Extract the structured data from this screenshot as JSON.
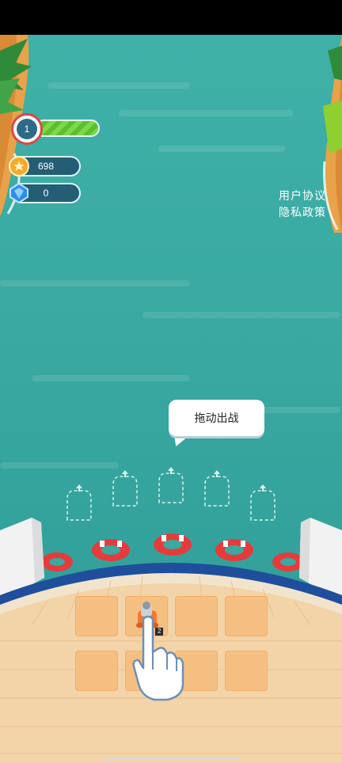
{
  "hud": {
    "level": "1",
    "level_progress": 1.0,
    "coins": "698",
    "gems": "0"
  },
  "legal": {
    "user_agreement": "用户协议",
    "privacy_policy": "隐私政策"
  },
  "tutorial": {
    "bubble_text": "拖动出战"
  },
  "grid": {
    "unit_level": "2"
  },
  "colors": {
    "sea": "#3fb1a7",
    "tile": "#f6bf82",
    "deck": "#f3d3a8",
    "rail_blue": "#1f4f9c"
  }
}
